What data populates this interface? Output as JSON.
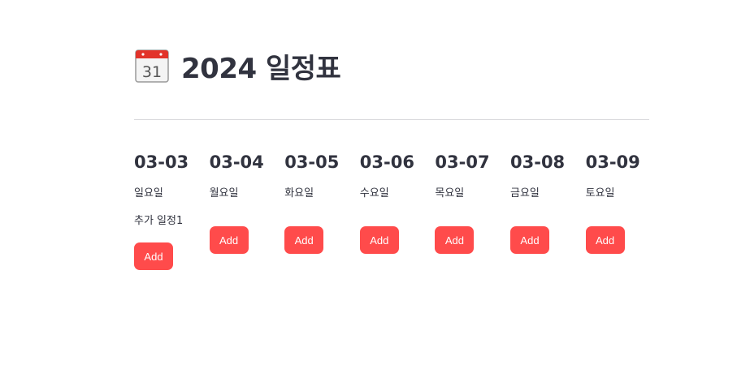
{
  "header": {
    "icon": "calendar-31-icon",
    "icon_text": "31",
    "title": "2024 일정표"
  },
  "colors": {
    "accent": "#ff4b4b",
    "text": "#31333f",
    "divider": "#d9d9dc"
  },
  "days": [
    {
      "date": "03-03",
      "weekday": "일요일",
      "events": [
        "추가 일정1"
      ],
      "button_label": "Add"
    },
    {
      "date": "03-04",
      "weekday": "월요일",
      "events": [],
      "button_label": "Add"
    },
    {
      "date": "03-05",
      "weekday": "화요일",
      "events": [],
      "button_label": "Add"
    },
    {
      "date": "03-06",
      "weekday": "수요일",
      "events": [],
      "button_label": "Add"
    },
    {
      "date": "03-07",
      "weekday": "목요일",
      "events": [],
      "button_label": "Add"
    },
    {
      "date": "03-08",
      "weekday": "금요일",
      "events": [],
      "button_label": "Add"
    },
    {
      "date": "03-09",
      "weekday": "토요일",
      "events": [],
      "button_label": "Add"
    }
  ]
}
